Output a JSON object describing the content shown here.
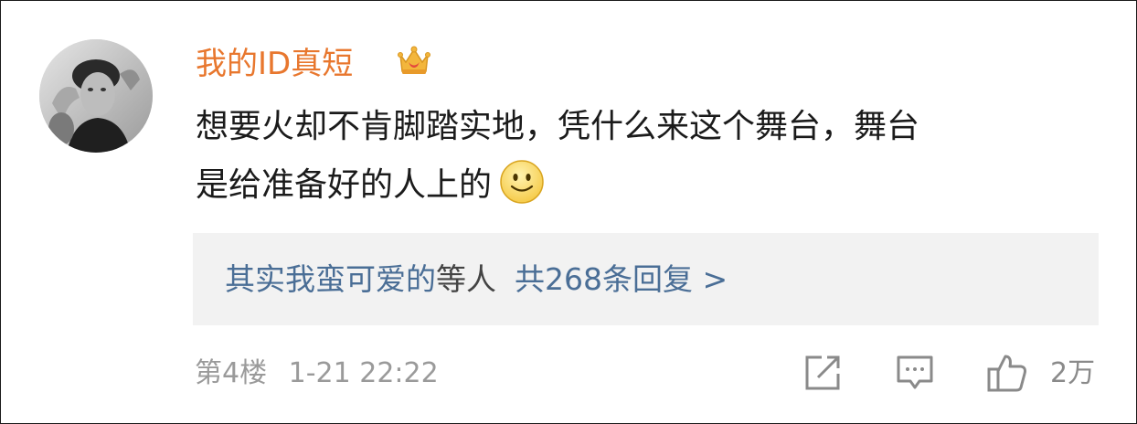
{
  "comment": {
    "username": "我的ID真短",
    "username_color": "#e8772e",
    "badge_icon": "crown-badge-icon",
    "content_lines": [
      "想要火却不肯脚踏实地，凭什么来这个舞台，舞台",
      "是给准备好的人上的"
    ],
    "emoji_icon": "smiley-emoji-icon",
    "reply_preview": {
      "users": "其实我蛮可爱的",
      "and_text": "等人",
      "count_text": "共268条回复 >",
      "link_color": "#4a6e96"
    },
    "floor": "第4楼",
    "timestamp": "1-21 22:22",
    "actions": {
      "share_icon": "share-icon",
      "reply_icon": "comment-icon",
      "like_icon": "thumbs-up-icon",
      "like_count": "2万"
    }
  }
}
